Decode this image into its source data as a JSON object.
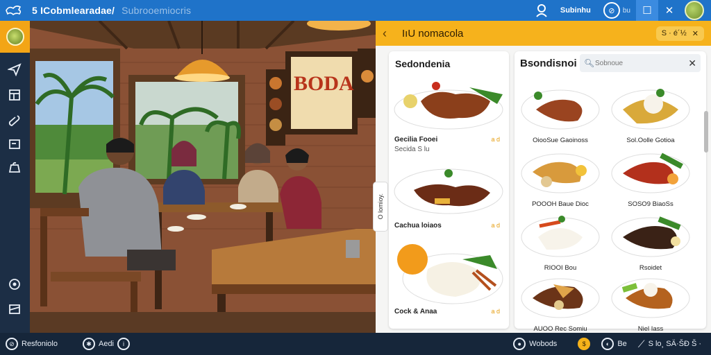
{
  "titlebar": {
    "logo_icon": "dragon-logo-icon",
    "app_title": "5  ICobmlearadae/",
    "app_subtitle": "Subrooemiocris",
    "user_label": "Subinhu",
    "help_label": "bu"
  },
  "sidebar": {
    "items": [
      {
        "icon": "send-icon"
      },
      {
        "icon": "menu-board-icon"
      },
      {
        "icon": "edit-icon"
      },
      {
        "icon": "terminal-icon"
      },
      {
        "icon": "cart-icon"
      },
      {
        "icon": "settings-icon"
      },
      {
        "icon": "window-icon"
      }
    ]
  },
  "panel": {
    "title": "IıU nomacola",
    "pill_label": "S   ·  é´½",
    "left_card": {
      "title": "Sedondenia",
      "dishes": [
        {
          "name": "Gecilia Fooei",
          "sub": "Secida S lu",
          "price": "a d"
        },
        {
          "name": "Cachua loiaos",
          "sub": "",
          "price": "a d"
        },
        {
          "name": "Cock & Anaa",
          "sub": "",
          "price": "a d"
        }
      ]
    },
    "right_card": {
      "title": "Bsondisnoi",
      "search_placeholder": "Sobnoue",
      "dishes": [
        {
          "name": "OiooSue Gaoinoss"
        },
        {
          "name": "Sol.Oolle Gotioa"
        },
        {
          "name": "POOOH Baue Dioc"
        },
        {
          "name": "SOSO9 BiaoSs"
        },
        {
          "name": "RIOOI Bou"
        },
        {
          "name": "Rsoidet"
        },
        {
          "name": "AUOO Rec Somiu"
        },
        {
          "name": "Niel Iass"
        }
      ]
    },
    "side_tab": "O lomioy."
  },
  "statusbar": {
    "left_label": "Resfoniolo",
    "nav_label": "Aedi",
    "right_label_1": "Wobods",
    "right_label_2": "Be",
    "right_label_3": "S lo¸ SÄ·ŠÐ Š ·"
  },
  "colors": {
    "titlebar": "#1f73c9",
    "accent": "#f6b21c",
    "sidebar": "#1c2e45",
    "statusbar": "#16263a",
    "price": "#e59d0e"
  }
}
